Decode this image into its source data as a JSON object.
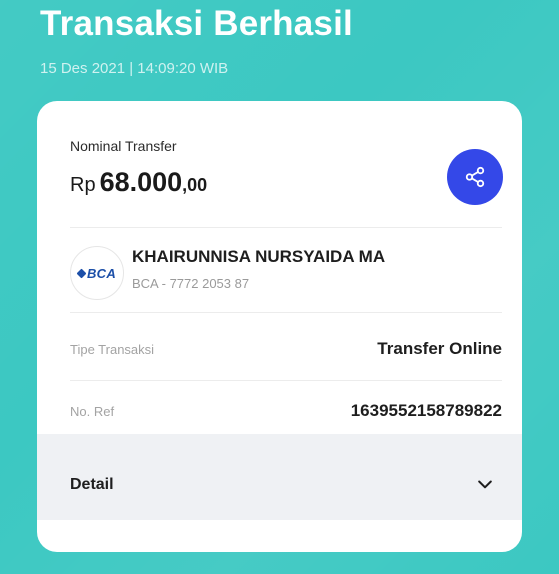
{
  "header": {
    "title": "Transaksi Berhasil",
    "datetime": "15 Des 2021 | 14:09:20 WIB"
  },
  "card": {
    "nominal_label": "Nominal Transfer",
    "amount": {
      "currency": "Rp",
      "value": "68.000",
      "decimals": ",00"
    },
    "share_button": {
      "icon": "share-icon"
    },
    "recipient": {
      "bank_logo_text": "BCA",
      "name": "KHAIRUNNISA NURSYAIDA MA",
      "account": "BCA - 7772 2053 87"
    },
    "transaction_type": {
      "label": "Tipe Transaksi",
      "value": "Transfer Online"
    },
    "reference": {
      "label": "No. Ref",
      "value": "1639552158789822"
    },
    "detail": {
      "label": "Detail",
      "icon": "chevron-down-icon"
    }
  },
  "colors": {
    "background": "#3cc8c2",
    "card": "#ffffff",
    "accent": "#3448e8",
    "detail_bg": "#eff1f4",
    "bank_brand": "#1c4fa8"
  }
}
